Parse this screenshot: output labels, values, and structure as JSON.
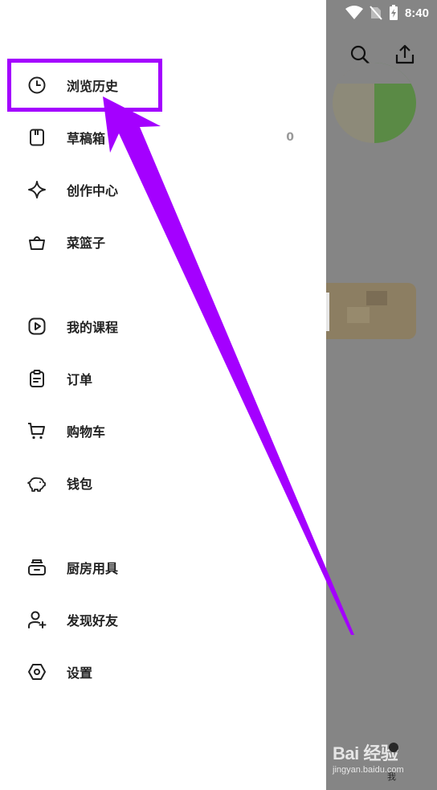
{
  "status_bar": {
    "time": "8:40"
  },
  "drawer": {
    "sections": [
      {
        "items": [
          {
            "key": "history",
            "label": "浏览历史",
            "icon": "clock-icon"
          },
          {
            "key": "drafts",
            "label": "草稿箱",
            "icon": "draft-box-icon",
            "count": "0"
          },
          {
            "key": "creator",
            "label": "创作中心",
            "icon": "sparkle-icon"
          },
          {
            "key": "basket",
            "label": "菜篮子",
            "icon": "basket-icon"
          }
        ]
      },
      {
        "items": [
          {
            "key": "courses",
            "label": "我的课程",
            "icon": "play-icon"
          },
          {
            "key": "orders",
            "label": "订单",
            "icon": "clipboard-icon"
          },
          {
            "key": "cart",
            "label": "购物车",
            "icon": "cart-icon"
          },
          {
            "key": "wallet",
            "label": "钱包",
            "icon": "piggy-bank-icon"
          }
        ]
      },
      {
        "items": [
          {
            "key": "kitchenware",
            "label": "厨房用具",
            "icon": "cookware-icon"
          },
          {
            "key": "friends",
            "label": "发现好友",
            "icon": "add-user-icon"
          },
          {
            "key": "settings",
            "label": "设置",
            "icon": "hexagon-gear-icon"
          }
        ]
      }
    ]
  },
  "background_app": {
    "header_icons": [
      "search-icon",
      "share-icon"
    ],
    "bottom_tab_label": "我"
  },
  "watermark": {
    "logo": "Bai 经验",
    "url": "jingyan.baidu.com"
  },
  "annotation": {
    "color": "#a400ff"
  }
}
